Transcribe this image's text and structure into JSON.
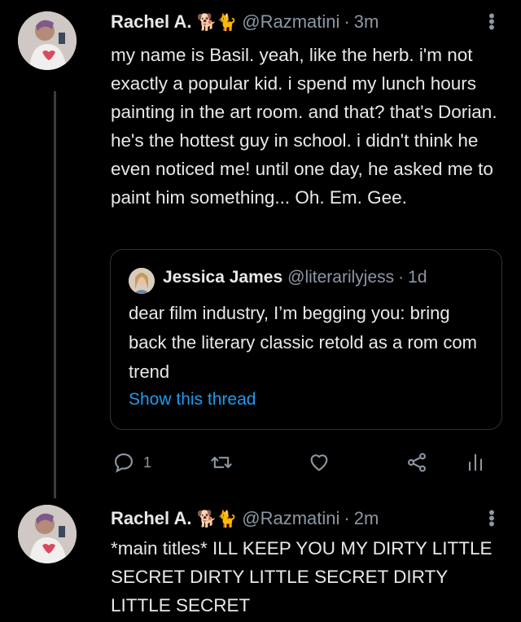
{
  "tweets": [
    {
      "author": "Rachel A.",
      "emoji": "🐕🐈",
      "handle": "@Razmatini",
      "time": "3m",
      "text": "my name is Basil. yeah, like the herb. i'm not exactly a popular kid. i spend my lunch hours painting in the art room. and that? that's Dorian. he's the hottest guy in school. i didn't think he even noticed me! until one day, he asked me to paint him something... Oh. Em. Gee.",
      "quoted": {
        "author": "Jessica James",
        "handle": "@literarilyjess",
        "time": "1d",
        "text": "dear film industry, I’m begging you: bring back the literary classic retold as a rom com trend",
        "link": "Show this thread"
      },
      "actions": {
        "reply_count": "1",
        "icons": [
          "reply-icon",
          "retweet-icon",
          "like-icon",
          "share-icon",
          "analytics-icon"
        ]
      }
    },
    {
      "author": "Rachel A.",
      "emoji": "🐕🐈",
      "handle": "@Razmatini",
      "time": "2m",
      "text": "*main titles* ILL KEEP YOU MY DIRTY LITTLE SECRET DIRTY LITTLE SECRET DIRTY LITTLE SECRET"
    }
  ],
  "colors": {
    "background": "#000000",
    "text": "#e7e9ea",
    "secondary": "#8b98a5",
    "link": "#1d9bf0",
    "border": "#2f3336"
  }
}
